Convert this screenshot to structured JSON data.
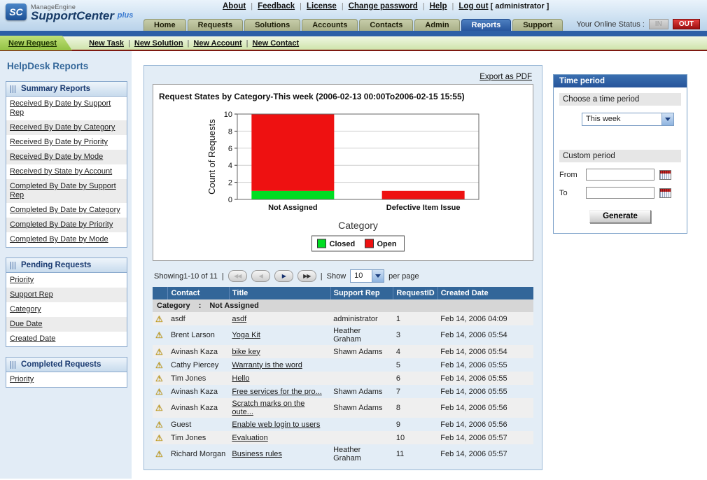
{
  "header": {
    "logo": {
      "icon_text": "SC",
      "brand": "ManageEngine",
      "product": "SupportCenter",
      "plus": "plus"
    },
    "links": [
      "About",
      "Feedback",
      "License",
      "Change password",
      "Help",
      "Log out"
    ],
    "user_suffix": "[ administrator ]",
    "online_status_label": "Your Online Status :",
    "status_in": "IN",
    "status_out": "OUT"
  },
  "tabs": [
    {
      "label": "Home",
      "active": false
    },
    {
      "label": "Requests",
      "active": false
    },
    {
      "label": "Solutions",
      "active": false
    },
    {
      "label": "Accounts",
      "active": false
    },
    {
      "label": "Contacts",
      "active": false
    },
    {
      "label": "Admin",
      "active": false
    },
    {
      "label": "Reports",
      "active": true
    },
    {
      "label": "Support",
      "active": false
    }
  ],
  "actionbar": {
    "new_request": "New Request",
    "links": [
      "New Task",
      "New Solution",
      "New Account",
      "New Contact"
    ]
  },
  "sidebar": {
    "title": "HelpDesk Reports",
    "sections": [
      {
        "title": "Summary Reports",
        "items": [
          "Received By Date by Support Rep",
          "Received By Date by Category",
          "Received By Date by Priority",
          "Received By Date by Mode",
          "Received by State by Account",
          "Completed By Date by Support Rep",
          "Completed By Date by Category",
          "Completed By Date by Priority",
          "Completed By Date by Mode"
        ]
      },
      {
        "title": "Pending Requests",
        "items": [
          "Priority",
          "Support Rep",
          "Category",
          "Due Date",
          "Created Date"
        ]
      },
      {
        "title": "Completed Requests",
        "items": [
          "Priority"
        ]
      }
    ]
  },
  "main": {
    "export_link": "Export as PDF",
    "chart_title": "Request States by Category-This week (2006-02-13 00:00To2006-02-15 15:55)",
    "paging": {
      "showing": "Showing1-10 of 11",
      "sep": "|",
      "show_label": "Show",
      "per_page": "10",
      "per_page_suffix": "per page"
    },
    "table": {
      "columns": [
        "",
        "Contact",
        "Title",
        "Support Rep",
        "RequestID",
        "Created Date"
      ],
      "group_label": "Category",
      "group_separator": ":",
      "group_value": "Not Assigned",
      "rows": [
        {
          "contact": "asdf",
          "title": "asdf",
          "support_rep": "administrator",
          "request_id": "1",
          "created": "Feb 14, 2006 04:09"
        },
        {
          "contact": "Brent Larson",
          "title": "Yoga Kit",
          "support_rep": "Heather Graham",
          "request_id": "3",
          "created": "Feb 14, 2006 05:54"
        },
        {
          "contact": "Avinash Kaza",
          "title": "bike key",
          "support_rep": "Shawn Adams",
          "request_id": "4",
          "created": "Feb 14, 2006 05:54"
        },
        {
          "contact": "Cathy Piercey",
          "title": "Warranty is the word",
          "support_rep": "",
          "request_id": "5",
          "created": "Feb 14, 2006 05:55"
        },
        {
          "contact": "Tim Jones",
          "title": "Hello",
          "support_rep": "",
          "request_id": "6",
          "created": "Feb 14, 2006 05:55"
        },
        {
          "contact": "Avinash Kaza",
          "title": "Free services for the pro...",
          "support_rep": "Shawn Adams",
          "request_id": "7",
          "created": "Feb 14, 2006 05:55"
        },
        {
          "contact": "Avinash Kaza",
          "title": "Scratch marks on the oute...",
          "support_rep": "Shawn Adams",
          "request_id": "8",
          "created": "Feb 14, 2006 05:56"
        },
        {
          "contact": "Guest",
          "title": "Enable web login to users",
          "support_rep": "",
          "request_id": "9",
          "created": "Feb 14, 2006 05:56"
        },
        {
          "contact": "Tim Jones",
          "title": "Evaluation",
          "support_rep": "",
          "request_id": "10",
          "created": "Feb 14, 2006 05:57"
        },
        {
          "contact": "Richard Morgan",
          "title": "Business rules",
          "support_rep": "Heather Graham",
          "request_id": "11",
          "created": "Feb 14, 2006 05:57"
        }
      ]
    }
  },
  "time_period": {
    "title": "Time period",
    "choose_label": "Choose a time period",
    "selected": "This week",
    "custom_label": "Custom period",
    "from_label": "From",
    "to_label": "To",
    "generate_label": "Generate"
  },
  "icons": {
    "first_page": "◀◀",
    "prev_page": "◀",
    "next_page": "▶",
    "last_page": "▶▶",
    "warning": "⚠"
  },
  "colors": {
    "table_header": "#336699",
    "status_out": "#b01212",
    "active_tab": "#27559d",
    "closed_green": "#00dd22",
    "open_red": "#ee1111"
  },
  "chart_data": {
    "type": "bar",
    "stacked": true,
    "title": "Request States by Category-This week (2006-02-13 00:00To2006-02-15 15:55)",
    "categories": [
      "Not Assigned",
      "Defective Item Issue"
    ],
    "series": [
      {
        "name": "Closed",
        "color": "#00dd22",
        "values": [
          1,
          0
        ]
      },
      {
        "name": "Open",
        "color": "#ee1111",
        "values": [
          9,
          1
        ]
      }
    ],
    "xlabel": "Category",
    "ylabel": "Count of Requests",
    "ylim": [
      0,
      10
    ],
    "yticks": [
      0,
      2,
      4,
      6,
      8,
      10
    ],
    "grid": true,
    "legend_position": "bottom"
  }
}
